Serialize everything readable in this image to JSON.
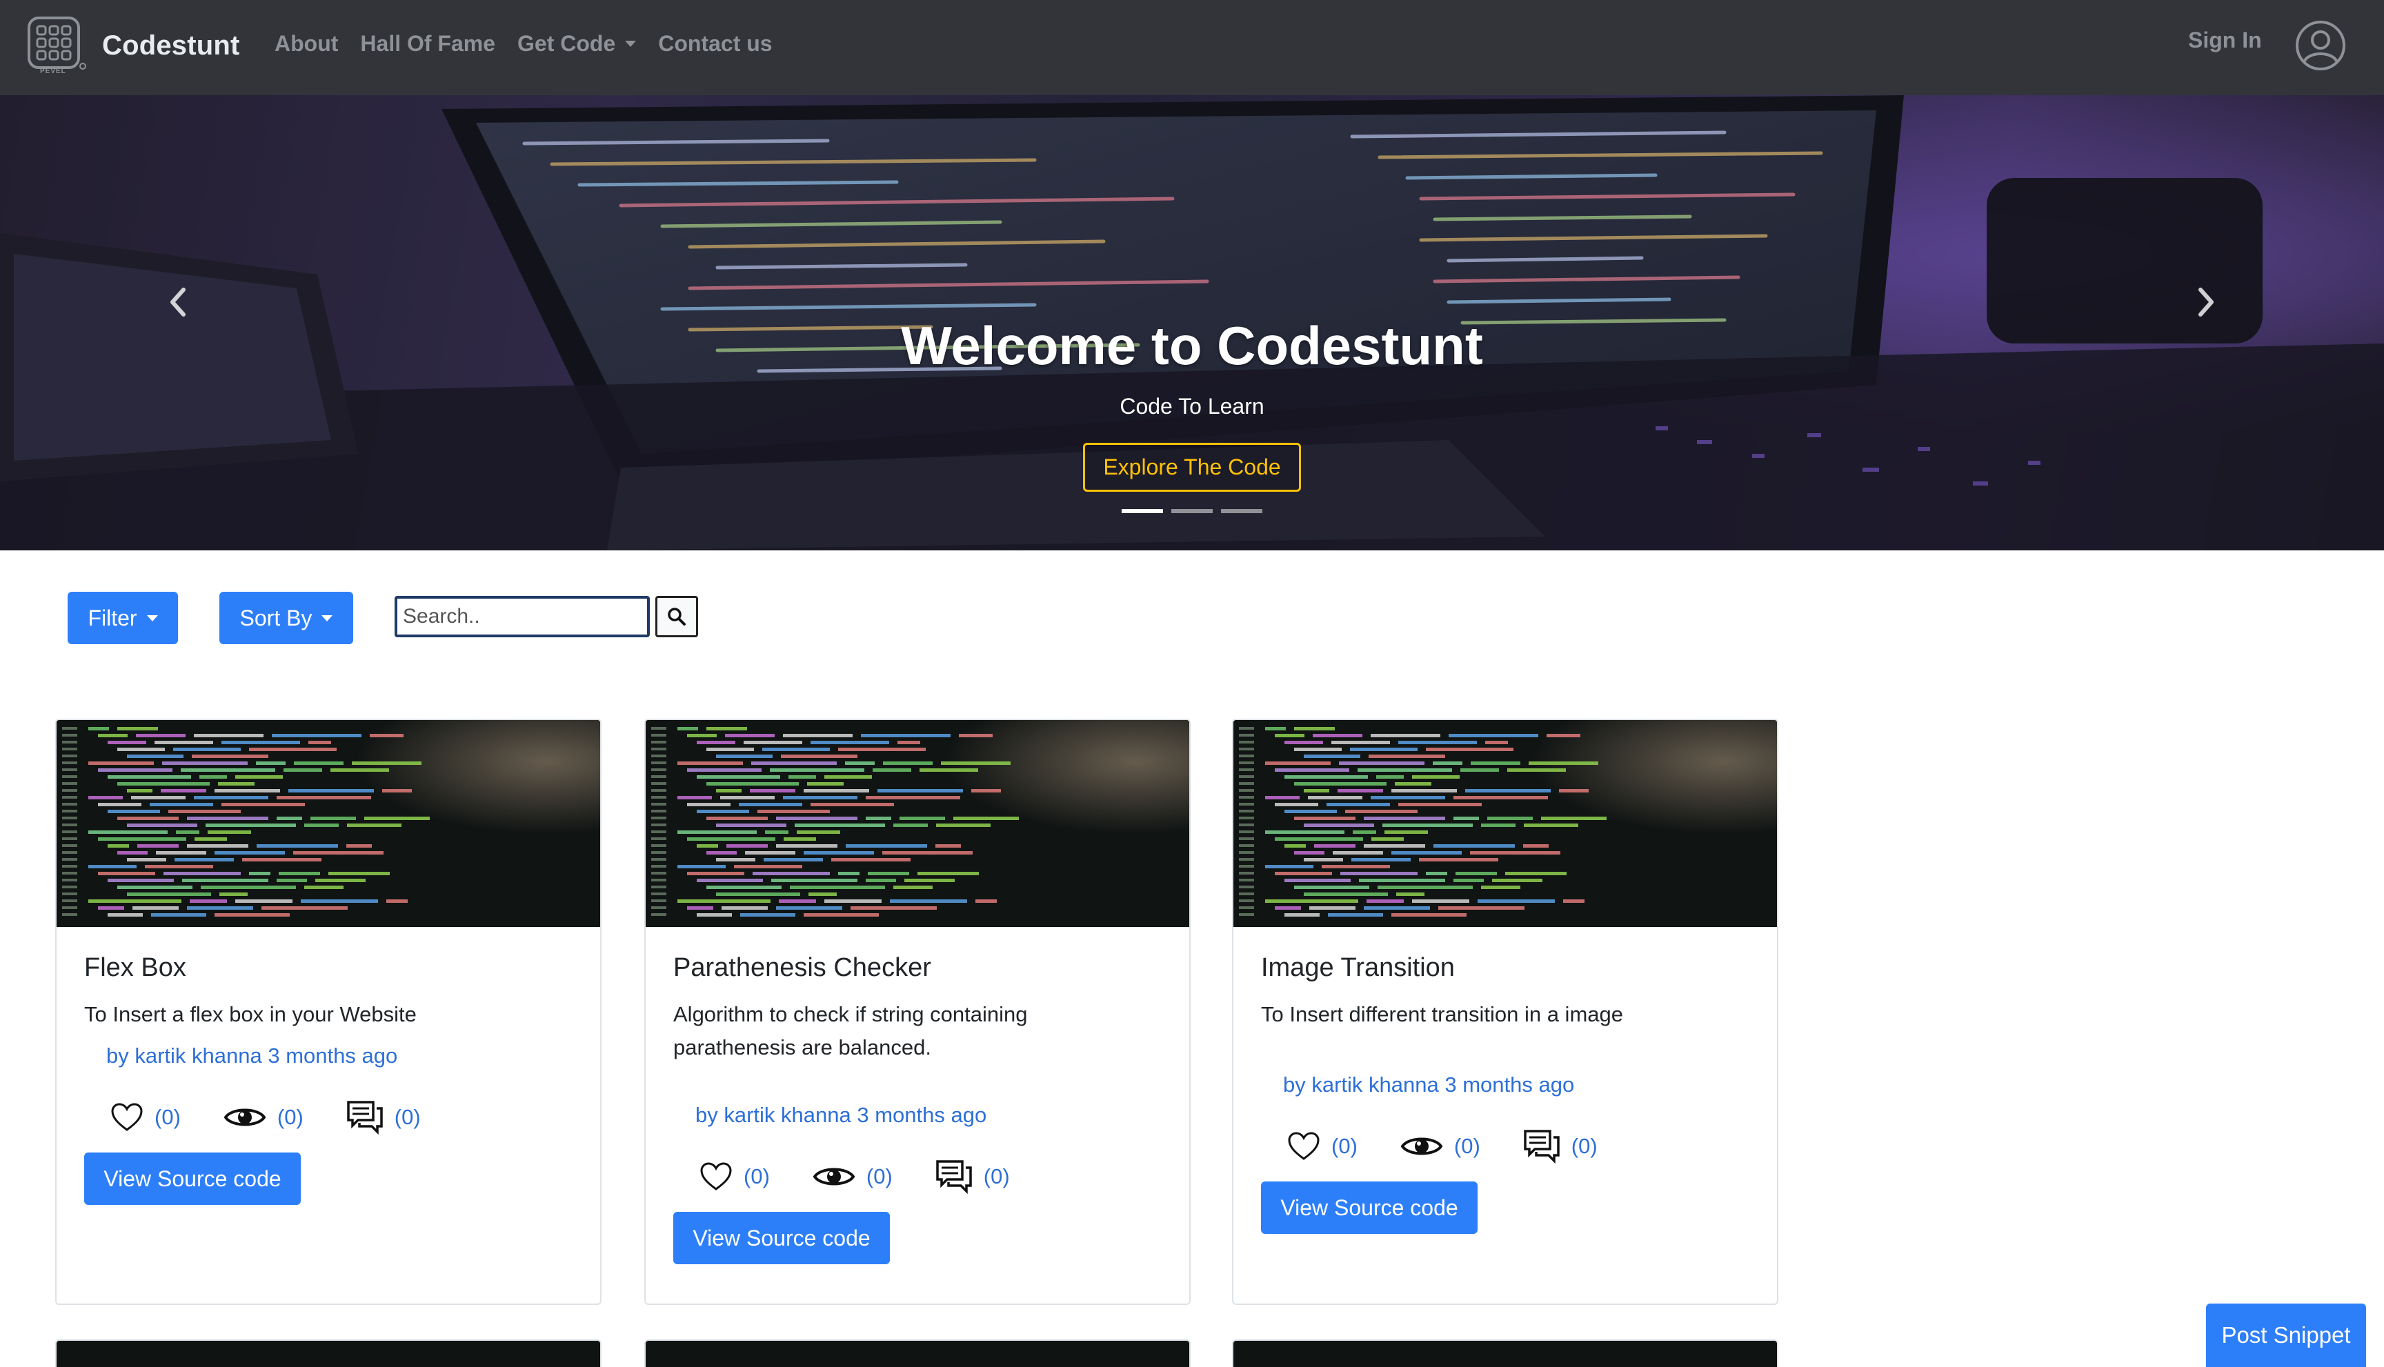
{
  "navbar": {
    "brand": "Codestunt",
    "logo_text": "PEVEL",
    "links": [
      {
        "label": "About"
      },
      {
        "label": "Hall Of Fame"
      },
      {
        "label": "Get Code"
      },
      {
        "label": "Contact us"
      }
    ],
    "signin": "Sign In",
    "icons": {
      "user": "user-circle-icon"
    }
  },
  "hero": {
    "title": "Welcome to Codestunt",
    "subtitle": "Code To Learn",
    "cta": "Explore The Code",
    "slide_count": 3,
    "active_slide": 0
  },
  "toolbar": {
    "filter": "Filter",
    "sort": "Sort By",
    "search_placeholder": "Search..",
    "search_value": ""
  },
  "cards": [
    {
      "title": "Flex Box",
      "text": "To Insert a flex box in your Website",
      "meta": "by kartik khanna 3 months ago",
      "likes": "(0)",
      "views": "(0)",
      "comments": "(0)",
      "button": "View Source code"
    },
    {
      "title": "Parathenesis Checker",
      "text": "Algorithm to check if string containing parathenesis are balanced.",
      "meta": "by kartik khanna 3 months ago",
      "likes": "(0)",
      "views": "(0)",
      "comments": "(0)",
      "button": "View Source code"
    },
    {
      "title": "Image Transition",
      "text": "To Insert different transition in a image",
      "meta": "by kartik khanna 3 months ago",
      "likes": "(0)",
      "views": "(0)",
      "comments": "(0)",
      "button": "View Source code"
    }
  ],
  "post_button": "Post Snippet",
  "colors": {
    "navbar": "#32343a",
    "primary": "#2d7ff9",
    "link": "#2d6fd8",
    "accent": "#ffc107"
  }
}
